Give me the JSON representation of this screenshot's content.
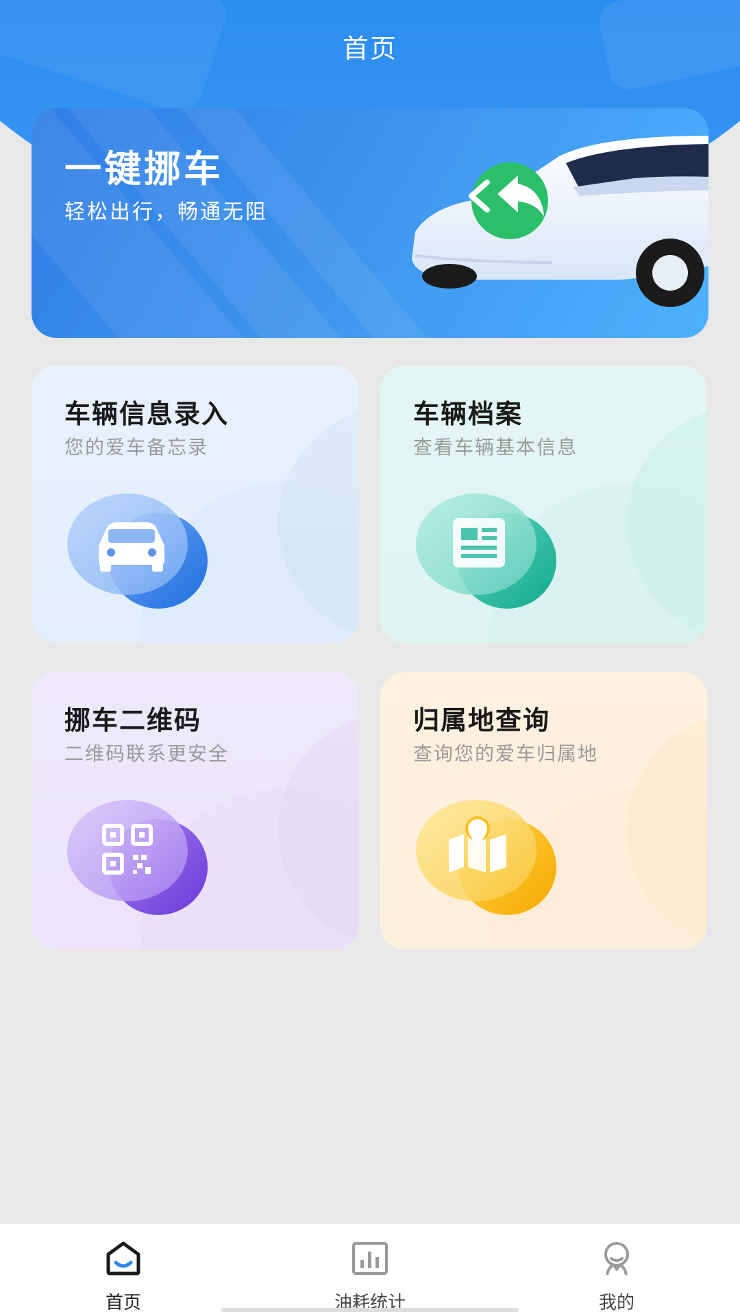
{
  "header": {
    "title": "首页"
  },
  "banner": {
    "title": "一键挪车",
    "subtitle": "轻松出行，畅通无阻",
    "icon": "car-return-icon"
  },
  "cards": [
    {
      "title": "车辆信息录入",
      "subtitle": "您的爱车备忘录",
      "icon": "car-icon",
      "color": "#2f7de6"
    },
    {
      "title": "车辆档案",
      "subtitle": "查看车辆基本信息",
      "icon": "document-icon",
      "color": "#1fb79b"
    },
    {
      "title": "挪车二维码",
      "subtitle": "二维码联系更安全",
      "icon": "qrcode-icon",
      "color": "#7d4fe0"
    },
    {
      "title": "归属地查询",
      "subtitle": "查询您的爱车归属地",
      "icon": "map-location-icon",
      "color": "#f7b500"
    }
  ],
  "tabbar": {
    "items": [
      {
        "label": "首页",
        "icon": "home-icon",
        "active": true
      },
      {
        "label": "油耗统计",
        "icon": "bar-chart-icon",
        "active": false
      },
      {
        "label": "我的",
        "icon": "user-icon",
        "active": false
      }
    ]
  }
}
